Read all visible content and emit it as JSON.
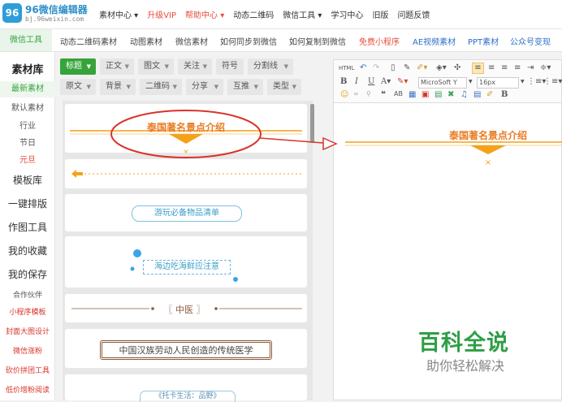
{
  "brand": {
    "logo_mark": "96",
    "name": "96微信编辑器",
    "url": "bj.96weixin.com"
  },
  "top_menu": [
    "素材中心 ▾",
    "升级VIP",
    "帮助中心 ▾",
    "动态二维码",
    "微信工具 ▾",
    "学习中心",
    "旧版",
    "问题反馈"
  ],
  "secondary_nav": [
    "微信工具",
    "动态二维码素材",
    "动图素材",
    "微信素材",
    "如何同步到微信",
    "如何复制到微信",
    "免费小程序",
    "AE视频素材",
    "PPT素材",
    "公众号变现"
  ],
  "sidebar": {
    "header": "素材库",
    "sub_items": [
      "最新素材",
      "默认素材",
      "行业",
      "节日",
      "元旦"
    ],
    "main_items": [
      "模板库",
      "一键排版",
      "作图工具",
      "我的收藏",
      "我的保存"
    ],
    "partner_label": "合作伙伴",
    "partner_links": [
      "小程序模板",
      "封面大图设计",
      "微信涨粉",
      "砍价拼团工具",
      "低价增粉阅读"
    ]
  },
  "filters_row1": [
    "标题",
    "正文",
    "图文",
    "关注",
    "符号",
    "分割线"
  ],
  "filters_row2": [
    "原文",
    "背景",
    "二维码",
    "分享",
    "互推",
    "类型"
  ],
  "cards": {
    "title_card": "泰国著名景点介绍",
    "card3_text": "游玩必备物品清单",
    "card4_text": "海边吃海鲜应注意",
    "card5_text": "〖 中医 〗",
    "card6_text": "中国汉族劳动人民创造的传统医学",
    "card7_text": "《托卡生活：品野》"
  },
  "editor": {
    "font_name": "MicroSoft Y",
    "font_size": "16px",
    "preview_title": "泰国著名景点介绍"
  },
  "watermark": {
    "title": "百科全说",
    "subtitle": "助你轻松解决"
  },
  "colors": {
    "accent": "#f5a11a",
    "highlight_red": "#d9342b",
    "brand_blue": "#2e8fc9",
    "active_green": "#36a43b"
  }
}
